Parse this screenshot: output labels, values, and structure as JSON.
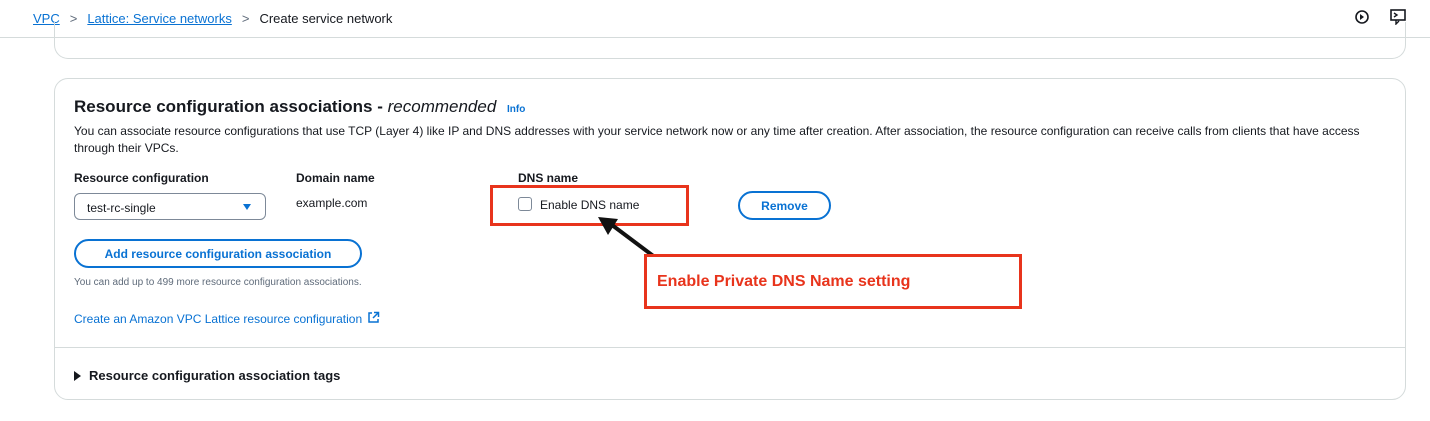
{
  "breadcrumb": {
    "items": [
      "VPC",
      "Lattice: Service networks"
    ],
    "current": "Create service network",
    "separator": ">"
  },
  "top_icons": [
    "notifications-icon",
    "cloudshell-icon"
  ],
  "section": {
    "title": "Resource configuration associations - ",
    "title_emphasis": "recommended",
    "info_label": "Info",
    "description": "You can associate resource configurations that use TCP (Layer 4) like IP and DNS addresses with your service network now or any time after creation. After association, the resource configuration can receive calls from clients that have access through their VPCs."
  },
  "columns": {
    "resource_configuration": "Resource configuration",
    "domain_name": "Domain name",
    "dns_name": "DNS name"
  },
  "row": {
    "resource_configuration_value": "test-rc-single",
    "domain_name_value": "example.com",
    "dns_checkbox_label": "Enable DNS name",
    "dns_checked": false,
    "remove_label": "Remove"
  },
  "add_button_label": "Add resource configuration association",
  "add_hint": "You can add up to 499 more resource configuration associations.",
  "create_link_label": "Create an Amazon VPC Lattice resource configuration",
  "annotation": {
    "callout_text": "Enable Private DNS Name setting",
    "color": "#e8341c"
  },
  "tags_section_label": "Resource configuration association tags",
  "colors": {
    "link": "#0972d3",
    "text": "#16191f",
    "border": "#d5dbdb"
  }
}
